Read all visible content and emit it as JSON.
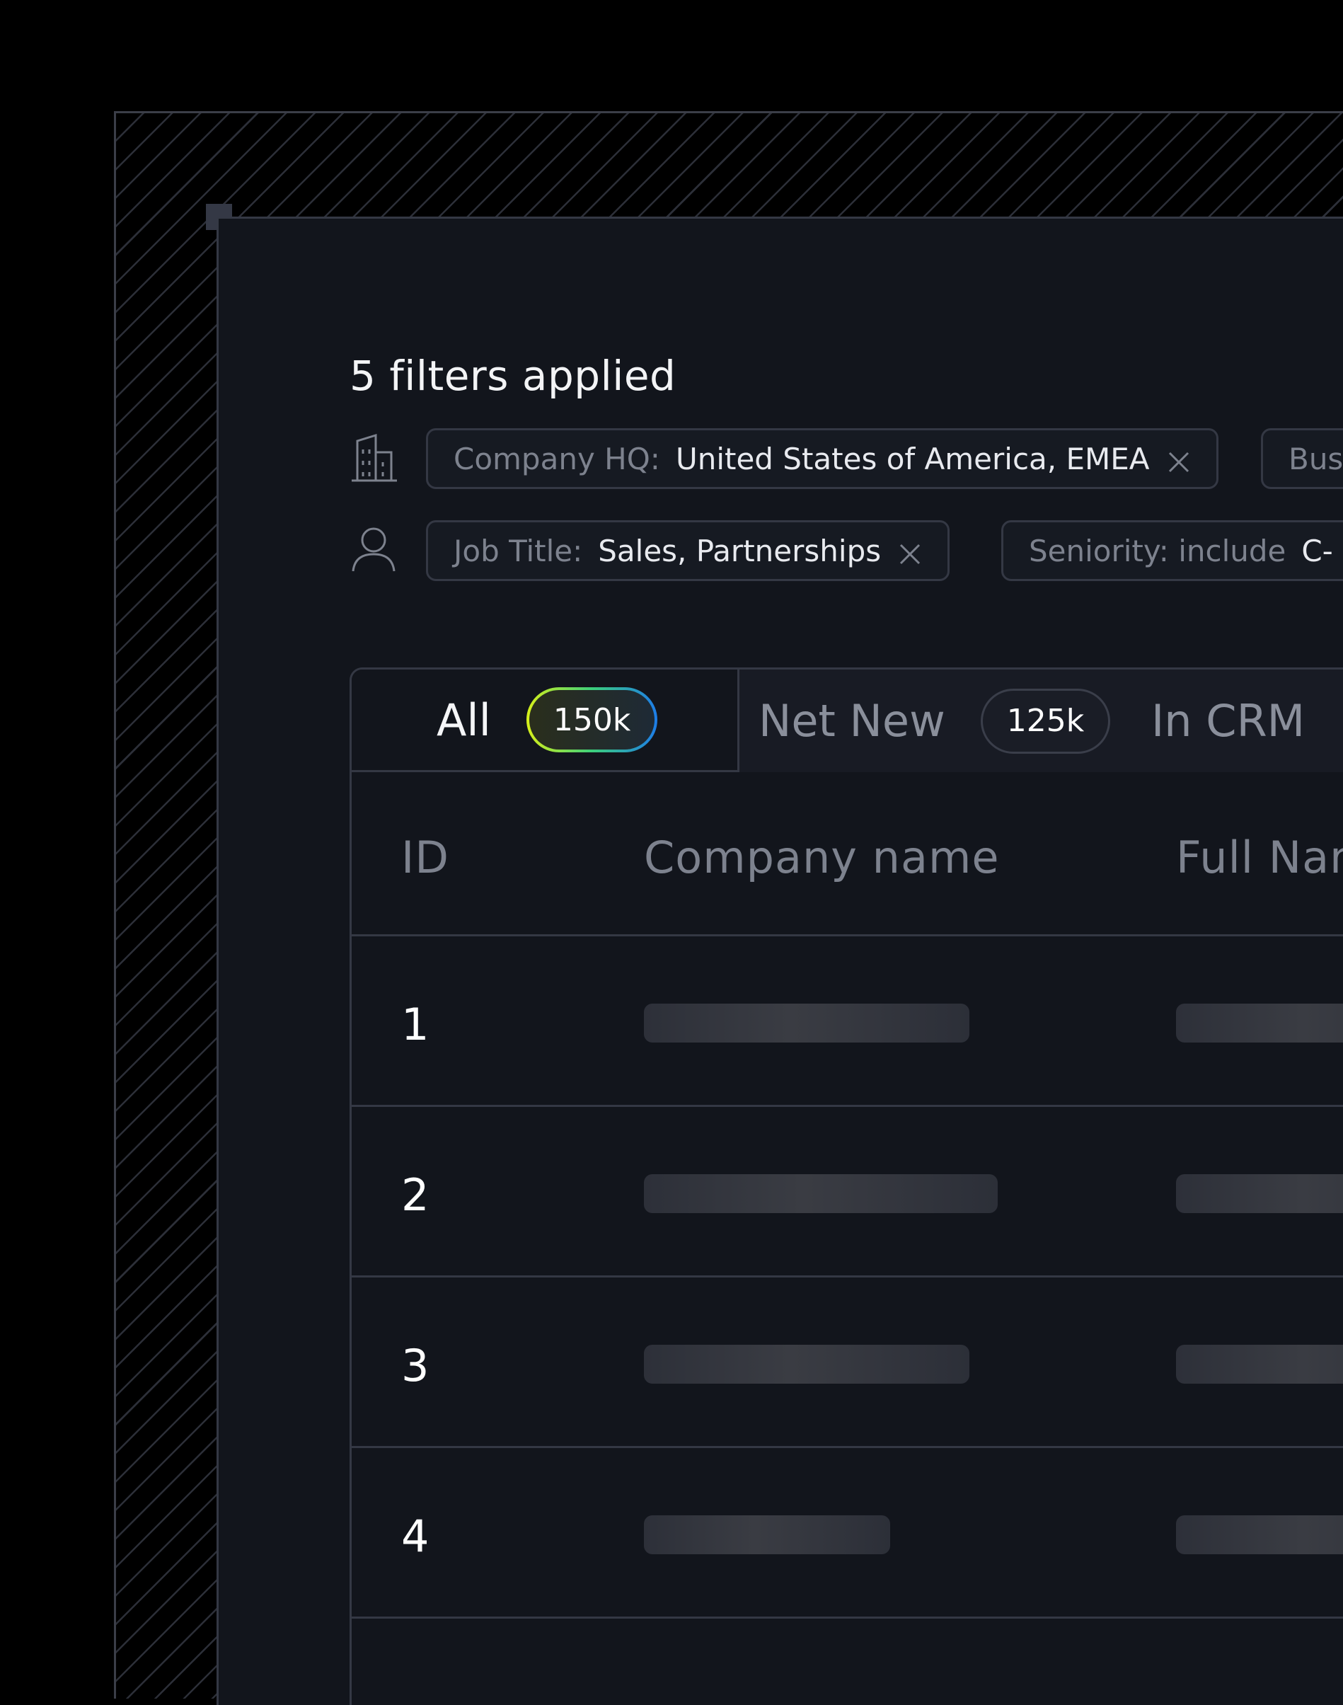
{
  "heading": "5 filters applied",
  "filter_rows": [
    {
      "icon": "building-icon",
      "chips": [
        {
          "key": "Company HQ:",
          "value": "United States of America, EMEA"
        },
        {
          "key": "Bus",
          "value": ""
        }
      ]
    },
    {
      "icon": "user-icon",
      "chips": [
        {
          "key": "Job Title:",
          "value": "Sales, Partnerships"
        },
        {
          "key": "Seniority: include",
          "value": "C-"
        }
      ]
    }
  ],
  "tabs": [
    {
      "label": "All",
      "count": "150k"
    },
    {
      "label": "Net New",
      "count": "125k"
    },
    {
      "label": "In CRM",
      "count": ""
    }
  ],
  "table": {
    "columns": [
      "ID",
      "Company name",
      "Full Nam"
    ],
    "rows": [
      {
        "id": "1"
      },
      {
        "id": "2"
      },
      {
        "id": "3"
      },
      {
        "id": "4"
      }
    ]
  },
  "colors": {
    "background": "#000000",
    "panel": "#12151c",
    "border": "#343844",
    "badge_gradient_start": "#d7f01a",
    "badge_gradient_end": "#1d7ce8"
  }
}
